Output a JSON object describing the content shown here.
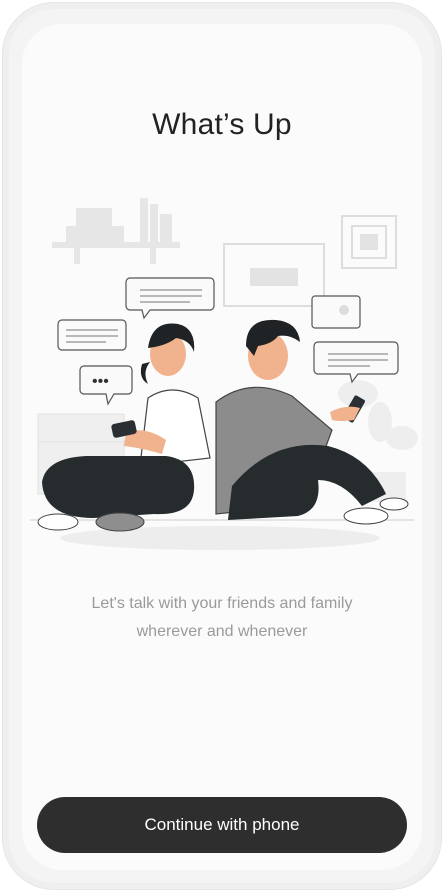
{
  "app": {
    "title": "What’s Up",
    "subtitle_line1": "Let's talk with your friends and family",
    "subtitle_line2": "wherever and whenever"
  },
  "actions": {
    "continue_label": "Continue with phone"
  },
  "illustration": {
    "name": "couple-chatting-illustration",
    "typing_indicator": "•••"
  },
  "colors": {
    "accent": "#2e2e2e",
    "title": "#222222",
    "subtitle": "#9a9a9a",
    "background": "#fbfbfb"
  }
}
